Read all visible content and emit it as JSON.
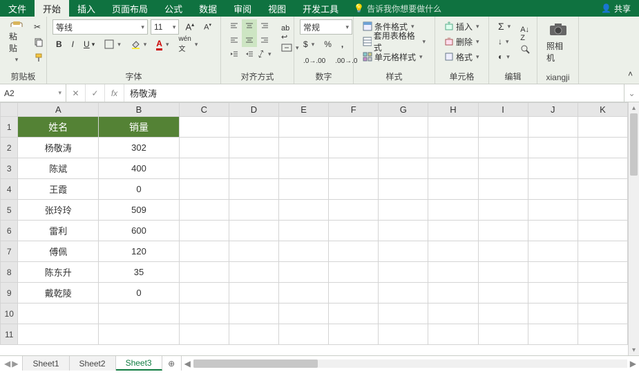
{
  "tabs": {
    "file": "文件",
    "home": "开始",
    "insert": "插入",
    "layout": "页面布局",
    "formulas": "公式",
    "data": "数据",
    "review": "审阅",
    "view": "视图",
    "dev": "开发工具"
  },
  "tellme": "告诉我你想要做什么",
  "share": "共享",
  "ribbon": {
    "paste": "粘贴",
    "clipboard": "剪贴板",
    "font_name": "等线",
    "font_size": "11",
    "font_group": "字体",
    "align_group": "对齐方式",
    "number_fmt": "常规",
    "number_group": "数字",
    "cond_fmt": "条件格式",
    "table_fmt": "套用表格格式",
    "cell_styles": "单元格样式",
    "styles_group": "样式",
    "insert_cells": "插入",
    "delete_cells": "删除",
    "format_cells": "格式",
    "cells_group": "单元格",
    "edit_group": "编辑",
    "camera": "照相机",
    "camera_group": "xiangji"
  },
  "namebox": "A2",
  "formula_value": "杨敬涛",
  "columns": [
    "A",
    "B",
    "C",
    "D",
    "E",
    "F",
    "G",
    "H",
    "I",
    "J",
    "K"
  ],
  "header_row": {
    "name": "姓名",
    "sales": "销量"
  },
  "rows": [
    {
      "n": "1"
    },
    {
      "n": "2",
      "name": "杨敬涛",
      "sales": "302"
    },
    {
      "n": "3",
      "name": "陈斌",
      "sales": "400"
    },
    {
      "n": "4",
      "name": "王霞",
      "sales": "0"
    },
    {
      "n": "5",
      "name": "张玲玲",
      "sales": "509"
    },
    {
      "n": "6",
      "name": "雷利",
      "sales": "600"
    },
    {
      "n": "7",
      "name": "傅佩",
      "sales": "120"
    },
    {
      "n": "8",
      "name": "陈东升",
      "sales": "35"
    },
    {
      "n": "9",
      "name": "戴乾陵",
      "sales": "0"
    },
    {
      "n": "10"
    },
    {
      "n": "11"
    }
  ],
  "sheets": {
    "s1": "Sheet1",
    "s2": "Sheet2",
    "s3": "Sheet3"
  }
}
